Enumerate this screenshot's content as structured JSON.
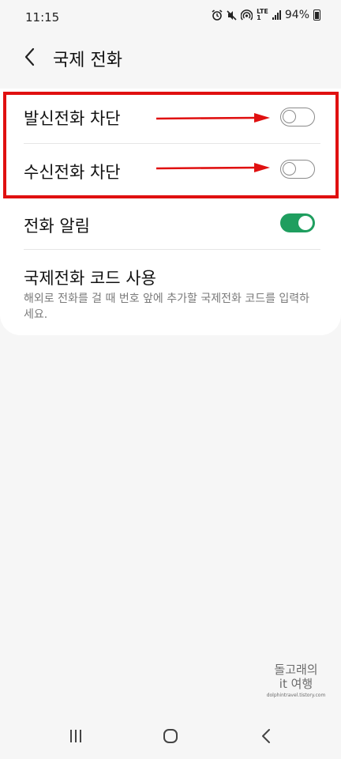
{
  "status_bar": {
    "time": "11:15",
    "network_label_top": "LTE",
    "network_label_bottom": "1",
    "battery": "94%"
  },
  "header": {
    "title": "국제 전화"
  },
  "settings": {
    "outgoing_block": {
      "label": "발신전화 차단",
      "enabled": false
    },
    "incoming_block": {
      "label": "수신전화 차단",
      "enabled": false
    },
    "call_alert": {
      "label": "전화 알림",
      "enabled": true
    },
    "intl_code": {
      "label": "국제전화 코드 사용",
      "description": "해외로 전화를 걸 때 번호 앞에 추가할 국제전화 코드를 입력하세요."
    }
  },
  "watermark": {
    "line1": "돌고래의",
    "line2": "it 여행",
    "url": "dolphintravel.tistory.com"
  },
  "colors": {
    "toggle_on": "#1f9e5f",
    "highlight": "#e01010"
  },
  "icons": [
    "alarm-icon",
    "mute-icon",
    "hotspot-icon",
    "signal-icon",
    "battery-icon",
    "back-arrow-icon",
    "recents-icon",
    "home-icon",
    "nav-back-icon"
  ]
}
